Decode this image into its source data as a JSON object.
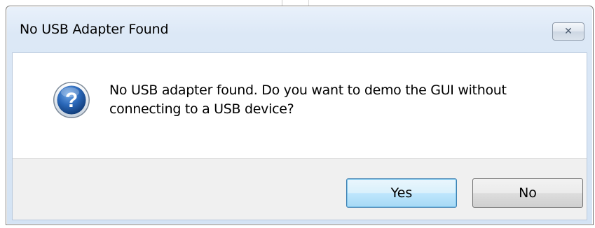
{
  "dialog": {
    "title": "No USB Adapter Found",
    "close_symbol": "✕",
    "icon": "question-icon",
    "message": "No USB adapter found.  Do you want to demo the GUI without connecting to a USB device?",
    "buttons": {
      "yes": "Yes",
      "no": "No"
    }
  },
  "colors": {
    "title_bar": "#dce8f6",
    "button_area": "#f0f0f0",
    "default_button_border": "#3c7fb1",
    "icon_blue": "#1c5fb0"
  }
}
